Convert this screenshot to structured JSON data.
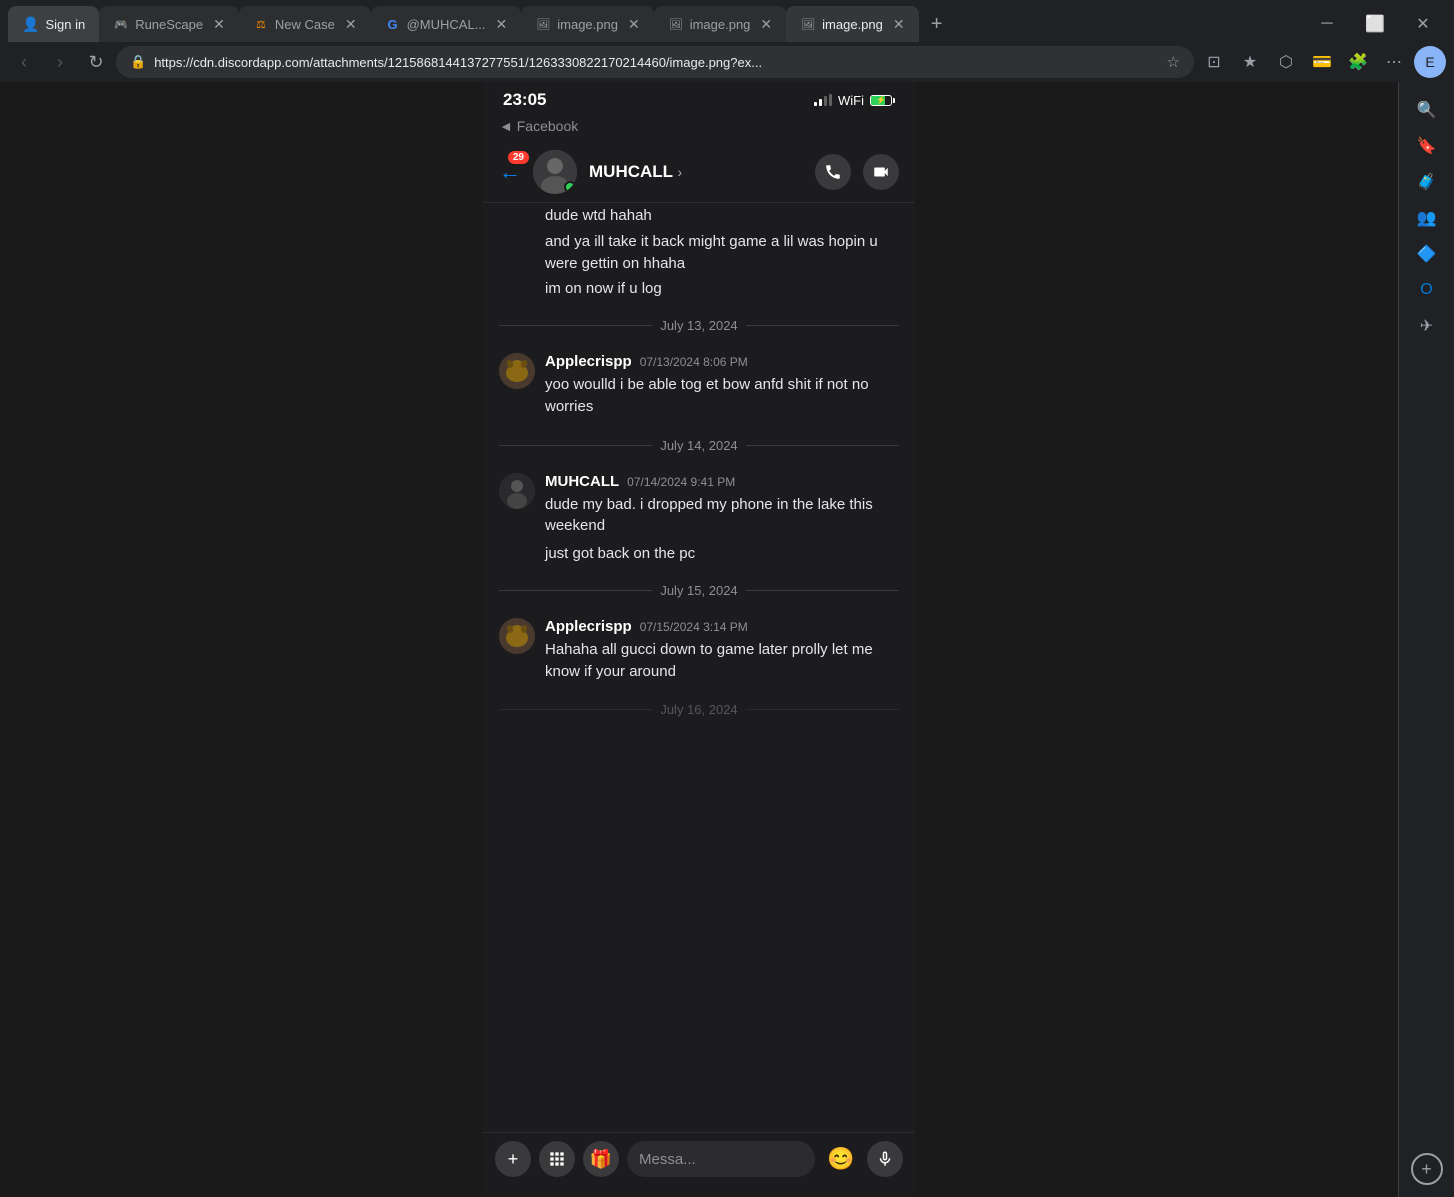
{
  "browser": {
    "tabs": [
      {
        "id": "signin",
        "label": "Sign in",
        "favicon": "👤",
        "active": false,
        "closeable": false
      },
      {
        "id": "runescape",
        "label": "RuneScape",
        "favicon": "🎮",
        "active": false,
        "closeable": true
      },
      {
        "id": "newcase",
        "label": "New Case",
        "favicon": "⚖",
        "active": false,
        "closeable": true
      },
      {
        "id": "muhcal",
        "label": "@MUHCAL...",
        "favicon": "G",
        "active": false,
        "closeable": true
      },
      {
        "id": "img1",
        "label": "image.png",
        "favicon": "🖼",
        "active": false,
        "closeable": true
      },
      {
        "id": "img2",
        "label": "image.png",
        "favicon": "🖼",
        "active": false,
        "closeable": true
      },
      {
        "id": "img3",
        "label": "image.png",
        "favicon": "🖼",
        "active": true,
        "closeable": true
      }
    ],
    "url": "https://cdn.discordapp.com/attachments/1215868144137277551/1263330822170214460/image.png?ex...",
    "window_controls": [
      "minimize",
      "maximize",
      "close"
    ]
  },
  "right_sidebar_icons": [
    "search",
    "bookmark",
    "briefcase",
    "people",
    "puzzle",
    "outlook",
    "send"
  ],
  "phone": {
    "status_bar": {
      "time": "23:05",
      "back_label": "◄ Facebook",
      "signal": "signal",
      "wifi": "wifi",
      "battery": "battery"
    },
    "chat_header": {
      "back_arrow": "←",
      "notification_count": "29",
      "username": "MUHCALL",
      "chevron": "›",
      "call_icon": "phone",
      "video_icon": "video"
    },
    "messages": [
      {
        "type": "continuation",
        "text": "dude wtd hahah"
      },
      {
        "type": "continuation",
        "text": "and ya ill take it back might game a lil was hopin u were gettin on hhaha"
      },
      {
        "type": "continuation",
        "text": "im on now if u log"
      },
      {
        "type": "date_divider",
        "label": "July 13, 2024"
      },
      {
        "type": "message",
        "sender": "Applecrispp",
        "timestamp": "07/13/2024 8:06 PM",
        "text": "yoo woulld i be  able tog et bow anfd shit if not no worries",
        "avatar_type": "dog"
      },
      {
        "type": "date_divider",
        "label": "July 14, 2024"
      },
      {
        "type": "message",
        "sender": "MUHCALL",
        "timestamp": "07/14/2024 9:41 PM",
        "text": "dude my bad. i dropped my phone in the lake this weekend",
        "avatar_type": "person"
      },
      {
        "type": "continuation",
        "text": "just got back on the pc"
      },
      {
        "type": "date_divider",
        "label": "July 15, 2024"
      },
      {
        "type": "message",
        "sender": "Applecrispp",
        "timestamp": "07/15/2024 3:14 PM",
        "text": "Hahaha all gucci down to game later prolly let me know if your around",
        "avatar_type": "dog"
      }
    ],
    "bottom_bar": {
      "plus_label": "+",
      "apps_label": "⊞",
      "gift_label": "🎁",
      "input_placeholder": "Messa...",
      "emoji_label": "😊",
      "mic_label": "🎤"
    }
  }
}
